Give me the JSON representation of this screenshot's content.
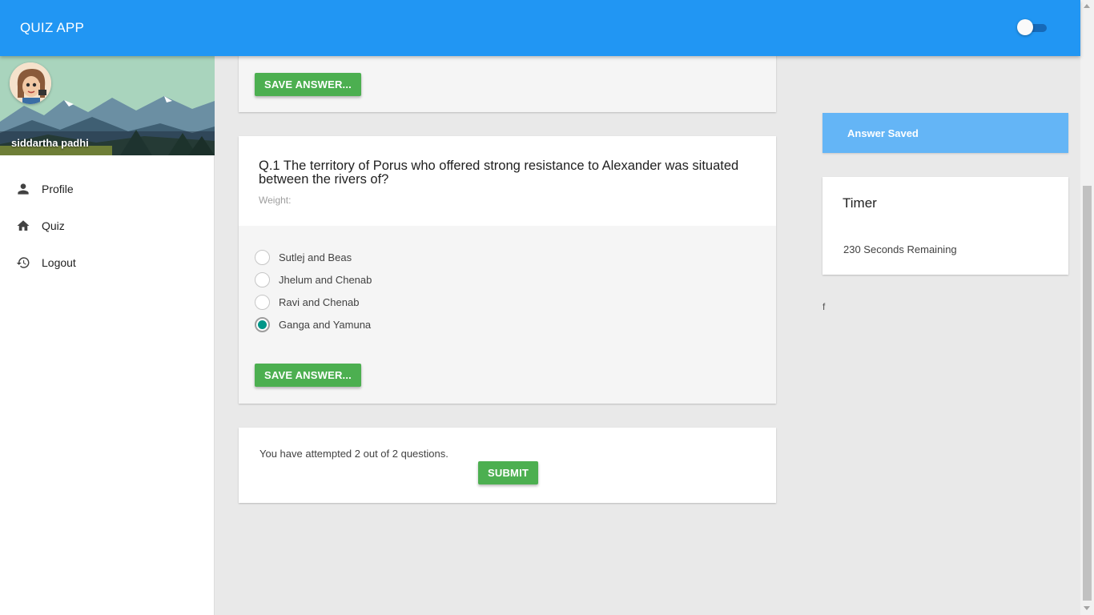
{
  "app": {
    "title": "QUIZ APP",
    "theme_toggle_on": false
  },
  "sidebar": {
    "username": "siddartha padhi",
    "items": [
      {
        "label": "Profile",
        "icon": "person-icon"
      },
      {
        "label": "Quiz",
        "icon": "home-icon"
      },
      {
        "label": "Logout",
        "icon": "history-icon"
      }
    ]
  },
  "main": {
    "prev_card": {
      "save_label": "SAVE ANSWER..."
    },
    "question": {
      "title": "Q.1 The territory of Porus who offered strong resistance to Alexander was situated between the rivers of?",
      "weight_label": "Weight:",
      "options": [
        {
          "label": "Sutlej and Beas",
          "checked": false
        },
        {
          "label": "Jhelum and Chenab",
          "checked": false
        },
        {
          "label": "Ravi and Chenab",
          "checked": false
        },
        {
          "label": "Ganga and Yamuna",
          "checked": true
        }
      ],
      "save_label": "SAVE ANSWER..."
    },
    "submit_card": {
      "attempt_text": "You have attempted 2 out of 2 questions.",
      "submit_label": "SUBMIT"
    }
  },
  "right": {
    "answer_saved": "Answer Saved",
    "timer": {
      "title": "Timer",
      "text": "230 Seconds Remaining"
    },
    "stray_text": "f"
  },
  "colors": {
    "appbar": "#2196f3",
    "button": "#4caf50",
    "saved_banner": "#64b5f6",
    "radio_checked": "#009688"
  }
}
